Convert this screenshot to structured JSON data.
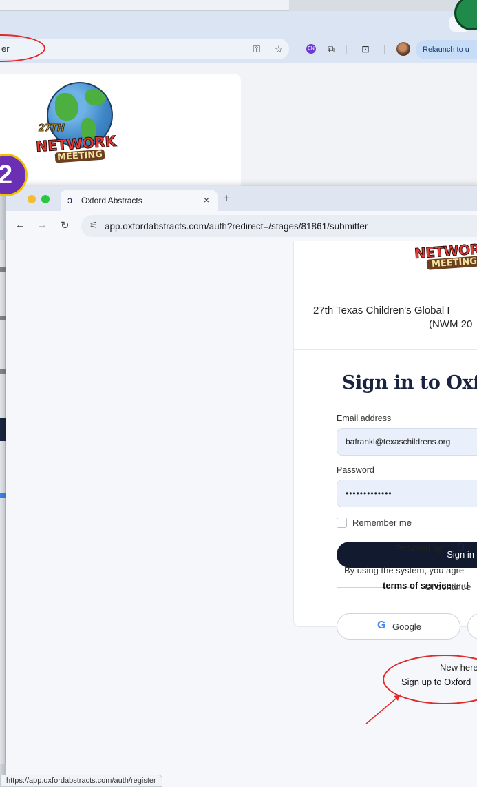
{
  "background_window": {
    "omnibox_text": "er",
    "gemini_label": "✦",
    "relaunch_label": "Relaunch to u",
    "ext_label": "EN",
    "icons": [
      "key-icon",
      "star-icon",
      "extension-icon",
      "puzzle-icon",
      "tab-search-icon",
      "profile-avatar"
    ]
  },
  "logo": {
    "number": "27TH",
    "word1": "NETWORK",
    "word2": "MEETING"
  },
  "step_badge": "2",
  "front_window": {
    "tab_title": "Oxford Abstracts",
    "url": "app.oxfordabstracts.com/auth?redirect=/stages/81861/submitter",
    "new_tab_label": "+",
    "close_label": "×"
  },
  "login": {
    "event_name_line1": "27th Texas Children's Global I",
    "event_name_line2": "(NWM 20",
    "heading": "Sign in to Oxfor",
    "email_label": "Email address",
    "email_value": "bafrankl@texaschildrens.org",
    "password_label": "Password",
    "password_value": "•••••••••••••",
    "remember_label": "Remember me",
    "signin_label": "Sign in",
    "or_continue": "Or continue",
    "google_label": "Google",
    "new_here": "New here",
    "signup_link": "Sign up to Oxford"
  },
  "footer": {
    "powered_by": "Powered by",
    "terms_line1": "By using the system, you agre",
    "terms_of_service": "terms of service",
    "terms_and": " and"
  },
  "status_bar": "https://app.oxfordabstracts.com/auth/register",
  "colors": {
    "annotation_red": "#e02b2b",
    "badge_purple": "#6a2fb2",
    "badge_yellow": "#f2c200",
    "signin_navy": "#111a2e"
  }
}
